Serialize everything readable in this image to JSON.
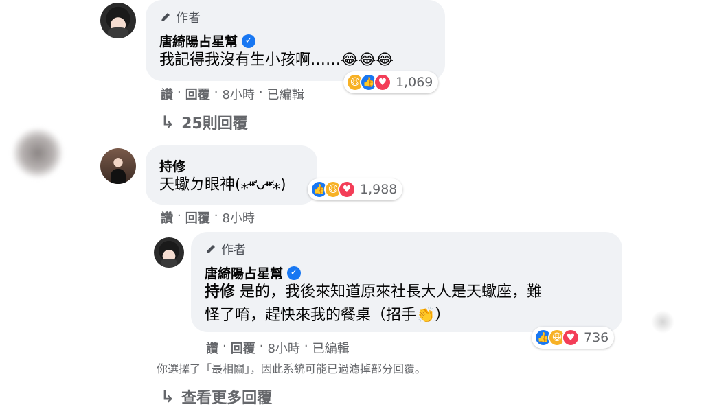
{
  "comments": [
    {
      "author_tag": "作者",
      "name": "唐綺陽占星幫",
      "text": "我記得我沒有生小孩啊……",
      "emoji": "😂😂😂",
      "reaction_count": "1,069",
      "actions": {
        "like": "讚",
        "reply": "回覆",
        "time": "8小時",
        "edited": "已編輯"
      },
      "view_replies": "25則回覆"
    },
    {
      "name": "持修",
      "text": "天蠍ㄉ眼神(⁎⁍̴̛ᴗ⁍̴̛⁎)",
      "reaction_count": "1,988",
      "actions": {
        "like": "讚",
        "reply": "回覆",
        "time": "8小時"
      }
    },
    {
      "author_tag": "作者",
      "name": "唐綺陽占星幫",
      "mention": "持修",
      "text_line1": " 是的，我後來知道原來社長大人是天蠍座，難",
      "text_line2": "怪了唷，趕快來我的餐桌（招手",
      "text_end": "）",
      "reaction_count": "736",
      "actions": {
        "like": "讚",
        "reply": "回覆",
        "time": "8小時",
        "edited": "已編輯"
      }
    }
  ],
  "filter_notice": "你選擇了「最相關」，因此系統可能已過濾掉部分回覆。",
  "view_more": "查看更多回覆",
  "colors": {
    "bubble": "#f0f2f5",
    "like": "#1877f2",
    "haha": "#f7b125",
    "love": "#f33e58",
    "meta": "#65676b"
  }
}
